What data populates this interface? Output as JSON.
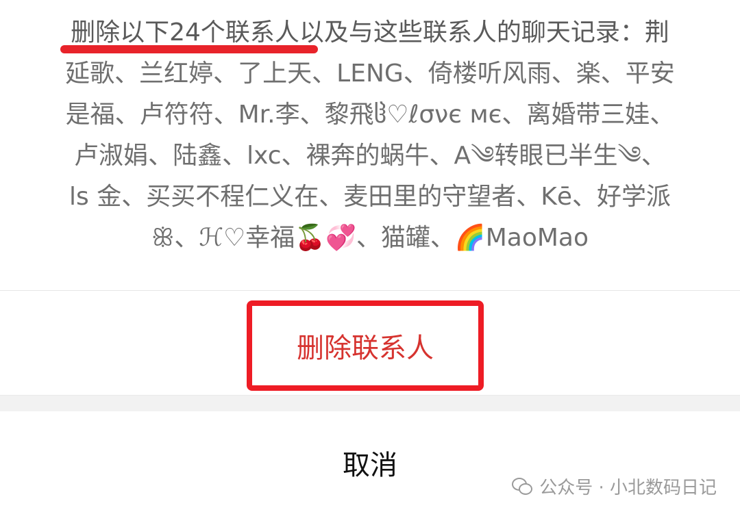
{
  "dialog": {
    "message_lines": [
      "删除以下24个联系人以及与这些联系人的聊天记录：荆",
      "延歌、兰红婷、了上天、LENG、倚楼听风雨、楽、平安",
      "是福、卢符符、Mr.李、黎飛ჱ♡ℓσνє мє、离婚带三娃、",
      "卢淑娟、陆鑫、lxc、裸奔的蜗牛、A༄转眼已半生༄、",
      "ls 金、买买不程仁义在、麦田里的守望者、Kē、好学派",
      "ꕥ、ℋ♡幸福🍒💞、猫罐、🌈MaoMao"
    ],
    "delete_button_label": "删除联系人",
    "cancel_button_label": "取消"
  },
  "watermark": {
    "text": "公众号 · 小北数码日记",
    "icon": "wechat-icon"
  },
  "colors": {
    "highlight_red": "#ee1c25",
    "delete_text": "#d6332f",
    "message_text": "#6f6f6f",
    "separator_band": "#f2f2f2"
  }
}
